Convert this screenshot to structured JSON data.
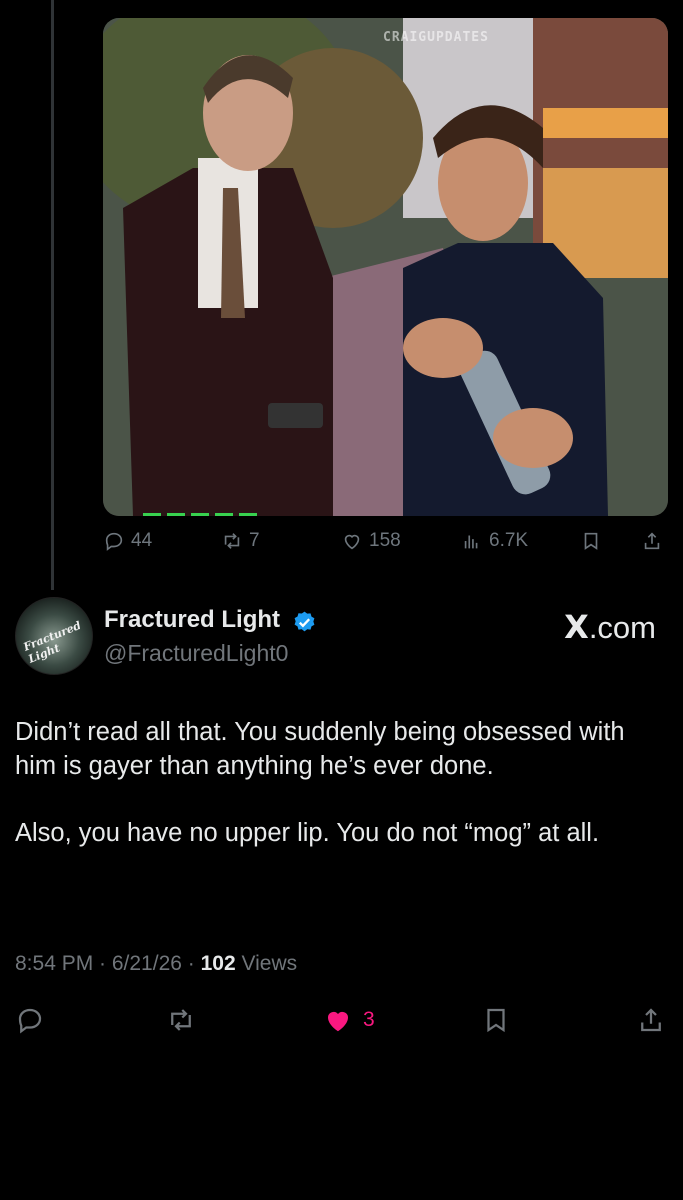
{
  "media": {
    "watermark": "CRAIGUPDATES"
  },
  "quoted_actions": {
    "replies": "44",
    "reposts": "7",
    "likes": "158",
    "views": "6.7K"
  },
  "author": {
    "display_name": "Fractured Light",
    "handle": "@FracturedLight0",
    "avatar_text": "Fractured Light",
    "verified_color": "#1d9bf0"
  },
  "brand": {
    "x_letter": "X",
    "domain": ".com"
  },
  "post": {
    "paragraph_1": "Didn’t read all that. You suddenly being obsessed with him is gayer than anything he’s ever done.",
    "paragraph_2": "Also, you have no upper lip. You do not “mog” at all."
  },
  "meta": {
    "time_date": "8:54 PM · 6/21/26 · ",
    "views_count": "102",
    "views_label": " Views"
  },
  "actions": {
    "likes": "3",
    "like_color": "#f91880"
  }
}
